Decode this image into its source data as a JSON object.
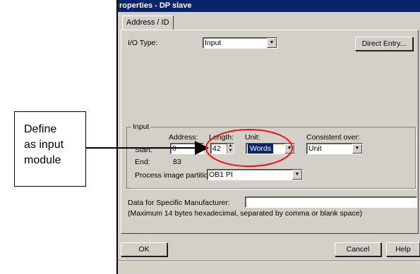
{
  "window": {
    "title": "roperties - DP slave"
  },
  "tabs": [
    {
      "label": "Address / ID"
    }
  ],
  "io_type": {
    "label": "I/O Type:",
    "value": "Input",
    "direct_entry_label": "Direct Entry..."
  },
  "input_group": {
    "title": "Input",
    "address_header": "Address:",
    "length_header": "Length:",
    "unit_header": "Unit:",
    "consistent_header": "Consistent over:",
    "start_label": "Start:",
    "start_value": "0",
    "end_label": "End:",
    "end_value": "83",
    "length_value": "42",
    "unit_value": "Words",
    "consistent_value": "Unit",
    "partition_label": "Process image partition",
    "partition_value": "OB1 PI"
  },
  "manufacturer": {
    "label": "Data for Specific Manufacturer:",
    "value": "",
    "hint": "(Maximum 14 bytes hexadecimal, separated by comma or blank space)"
  },
  "buttons": {
    "ok": "OK",
    "cancel": "Cancel",
    "help": "Help"
  },
  "callout": {
    "line1": "Define",
    "line2": "as input",
    "line3": "module"
  },
  "colors": {
    "highlight": "#e4141c",
    "selection": "#0a246a",
    "dialog_bg": "#d4d0c8"
  }
}
